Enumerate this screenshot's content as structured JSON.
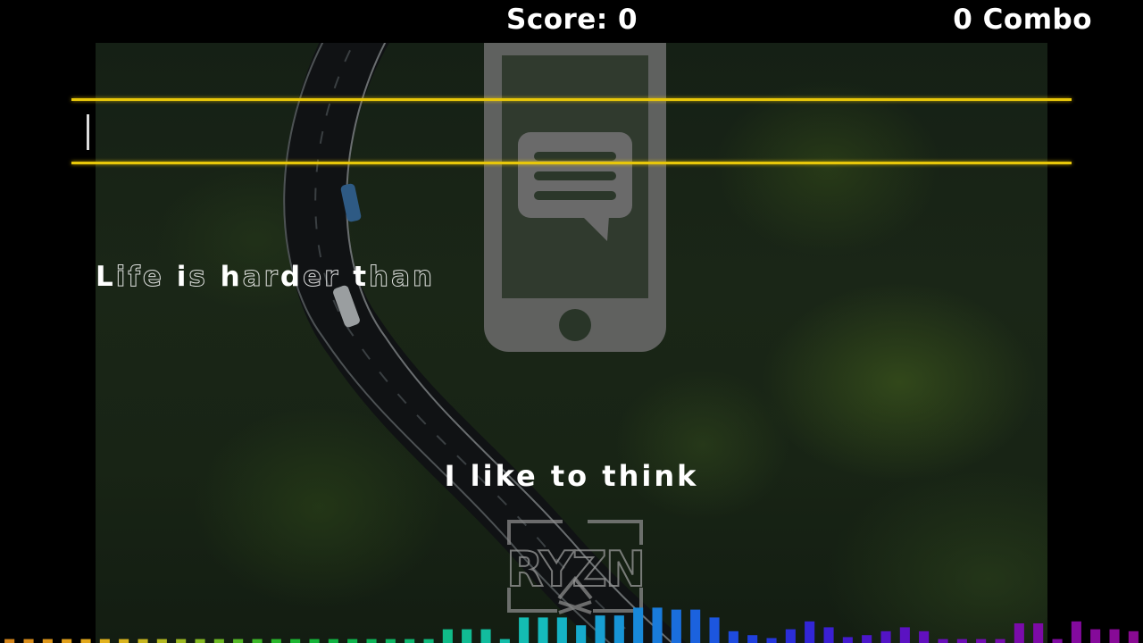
{
  "hud": {
    "score_text": "Score: 0",
    "combo_text": "0 Combo"
  },
  "typing": {
    "input_value": ""
  },
  "lyric_progress": {
    "segments": [
      {
        "text": "L",
        "done": true
      },
      {
        "text": "ife ",
        "done": false
      },
      {
        "text": "i",
        "done": true
      },
      {
        "text": "s ",
        "done": false
      },
      {
        "text": "h",
        "done": true
      },
      {
        "text": "ar",
        "done": false
      },
      {
        "text": "d",
        "done": true
      },
      {
        "text": "er ",
        "done": false
      },
      {
        "text": "t",
        "done": true
      },
      {
        "text": "han",
        "done": false
      }
    ]
  },
  "next_lyric": "I like to think",
  "logo": {
    "letters": "RYZN",
    "icon": "ryzn-logo"
  },
  "overlay_icon": "phone-message-icon",
  "colors": {
    "lane_line": "#e8c70a",
    "text": "#ffffff"
  },
  "visualizer": {
    "levels": [
      0.04,
      0.04,
      0.04,
      0.04,
      0.04,
      0.04,
      0.04,
      0.04,
      0.04,
      0.04,
      0.04,
      0.04,
      0.04,
      0.04,
      0.04,
      0.04,
      0.04,
      0.04,
      0.04,
      0.04,
      0.04,
      0.04,
      0.04,
      0.14,
      0.14,
      0.14,
      0.04,
      0.26,
      0.26,
      0.26,
      0.18,
      0.28,
      0.28,
      0.36,
      0.36,
      0.34,
      0.34,
      0.26,
      0.12,
      0.08,
      0.05,
      0.14,
      0.22,
      0.16,
      0.06,
      0.08,
      0.12,
      0.16,
      0.12,
      0.04,
      0.04,
      0.04,
      0.04,
      0.2,
      0.2,
      0.04,
      0.22,
      0.14,
      0.14,
      0.12
    ],
    "colors": [
      "#d4851b",
      "#d88d1b",
      "#dc961b",
      "#e09f1b",
      "#e2a81c",
      "#e2b21d",
      "#d9b41e",
      "#c7b61f",
      "#b3b821",
      "#9db922",
      "#86ba23",
      "#6eba25",
      "#55b927",
      "#3db829",
      "#2ab72c",
      "#1db632",
      "#16b53a",
      "#12b444",
      "#10b54e",
      "#0fb65a",
      "#0fb765",
      "#0fb871",
      "#10ba7d",
      "#10bb88",
      "#11bc93",
      "#12bd9e",
      "#13bda9",
      "#14bdb3",
      "#15bbbd",
      "#15b3c4",
      "#16aacc",
      "#179fd2",
      "#1794d6",
      "#1888d9",
      "#197bdb",
      "#1a6edd",
      "#1b62de",
      "#1c56df",
      "#1e4bdf",
      "#2040de",
      "#2536dc",
      "#2b2dd9",
      "#3226d6",
      "#3a20d2",
      "#431bce",
      "#4b17ca",
      "#5314c6",
      "#5b12c2",
      "#6210be",
      "#680fba",
      "#6d0eb6",
      "#720db2",
      "#760cae",
      "#7a0caa",
      "#7d0ba6",
      "#800ba2",
      "#830a9e",
      "#850a9a",
      "#870a96",
      "#890a92"
    ]
  }
}
